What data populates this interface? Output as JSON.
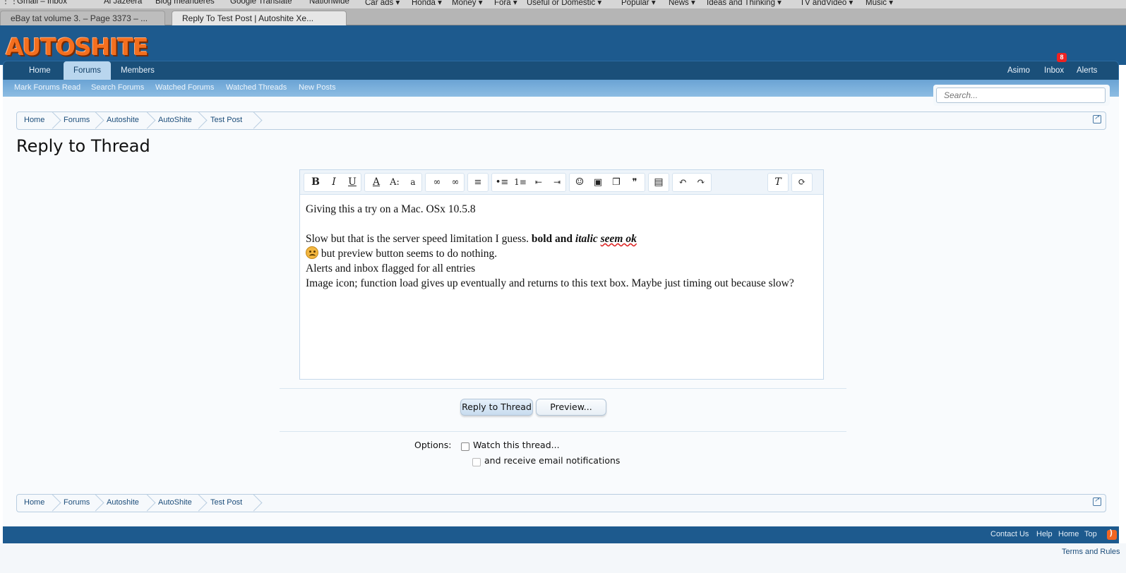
{
  "browser": {
    "bookmarks": [
      "Gmail – Inbox",
      "Al Jazeera",
      "Blog meanderes",
      "Google Translate",
      "Nationwide",
      "Car ads ▾",
      "Honda ▾",
      "Money ▾",
      "Fora ▾",
      "Useful or Domestic ▾",
      "Popular ▾",
      "News ▾",
      "Ideas and Thinking ▾",
      "TV andVideo ▾",
      "Music ▾"
    ],
    "tabs": [
      {
        "label": "eBay tat volume 3. – Page 3373 – ..."
      },
      {
        "label": "Reply To Test Post | Autoshite Xe..."
      }
    ]
  },
  "site": {
    "logo": "AUTOSHITE",
    "nav": [
      {
        "label": "Home"
      },
      {
        "label": "Forums"
      },
      {
        "label": "Members"
      }
    ],
    "nav_right": {
      "user": "Asimo",
      "inbox": "Inbox",
      "inbox_count": "8",
      "alerts": "Alerts"
    },
    "subnav": [
      "Mark Forums Read",
      "Search Forums",
      "Watched Forums",
      "Watched Threads",
      "New Posts"
    ],
    "search_placeholder": "Search..."
  },
  "breadcrumb": [
    "Home",
    "Forums",
    "Autoshite",
    "AutoShite",
    "Test Post"
  ],
  "page": {
    "title": "Reply to Thread"
  },
  "editor": {
    "toolbar_icons": [
      "bold-icon",
      "italic-icon",
      "underline-icon",
      "text-color-icon",
      "font-size-icon",
      "font-family-icon",
      "link-icon",
      "unlink-icon",
      "align-icon",
      "bullet-list-icon",
      "numbered-list-icon",
      "outdent-icon",
      "indent-icon",
      "smilie-icon",
      "image-icon",
      "media-icon",
      "quote-icon",
      "save-draft-icon",
      "undo-icon",
      "redo-icon",
      "remove-format-icon",
      "toggle-bbcode-icon"
    ],
    "lines": {
      "l1": "Giving this a try on a Mac. OSx 10.5.8",
      "l2a": "Slow but that is the server speed limitation I guess. ",
      "l2b": "bold and ",
      "l2c": "italic ",
      "l2d": "seem ok",
      "l3": " but preview button seems to do nothing.",
      "l4": "Alerts and inbox flagged for all entries",
      "l5": "Image icon; function load gives up eventually and returns to this text box. Maybe just timing out because slow?"
    }
  },
  "buttons": {
    "reply": "Reply to Thread",
    "preview": "Preview..."
  },
  "options": {
    "label": "Options:",
    "watch": "Watch this thread...",
    "email": "and receive email notifications",
    "watch_checked": false,
    "email_checked": false
  },
  "footer": {
    "links": [
      "Contact Us",
      "Help",
      "Home",
      "Top"
    ],
    "terms": "Terms and Rules"
  },
  "colors": {
    "header": "#1d5a8e",
    "logo": "#f46f1f",
    "badge": "#e22222",
    "subnav": "#8dbde3"
  }
}
